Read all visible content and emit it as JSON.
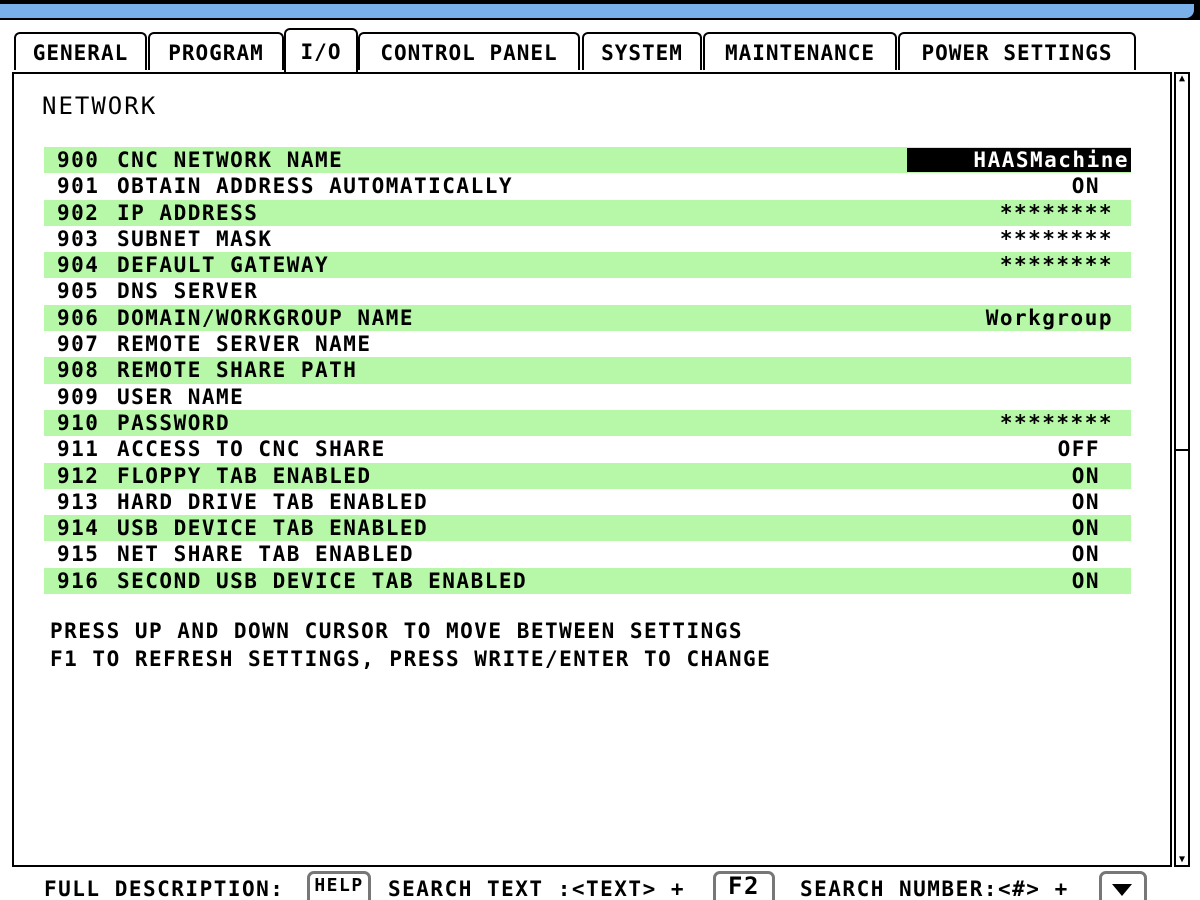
{
  "tabs": [
    {
      "label": "GENERAL"
    },
    {
      "label": "PROGRAM"
    },
    {
      "label": "I/O"
    },
    {
      "label": "CONTROL PANEL"
    },
    {
      "label": "SYSTEM"
    },
    {
      "label": "MAINTENANCE"
    },
    {
      "label": "POWER SETTINGS"
    }
  ],
  "active_tab": "I/O",
  "section": {
    "title": "NETWORK"
  },
  "settings": [
    {
      "num": "900",
      "label": "CNC NETWORK NAME",
      "value": "HAASMachine"
    },
    {
      "num": "901",
      "label": "OBTAIN ADDRESS AUTOMATICALLY",
      "value": "ON"
    },
    {
      "num": "902",
      "label": "IP ADDRESS",
      "value": "********"
    },
    {
      "num": "903",
      "label": "SUBNET MASK",
      "value": "********"
    },
    {
      "num": "904",
      "label": "DEFAULT GATEWAY",
      "value": "********"
    },
    {
      "num": "905",
      "label": "DNS SERVER",
      "value": ""
    },
    {
      "num": "906",
      "label": "DOMAIN/WORKGROUP NAME",
      "value": "Workgroup"
    },
    {
      "num": "907",
      "label": "REMOTE SERVER NAME",
      "value": ""
    },
    {
      "num": "908",
      "label": "REMOTE SHARE PATH",
      "value": ""
    },
    {
      "num": "909",
      "label": "USER NAME",
      "value": ""
    },
    {
      "num": "910",
      "label": "PASSWORD",
      "value": "********"
    },
    {
      "num": "911",
      "label": "ACCESS TO CNC SHARE",
      "value": "OFF"
    },
    {
      "num": "912",
      "label": "FLOPPY TAB ENABLED",
      "value": "ON"
    },
    {
      "num": "913",
      "label": "HARD DRIVE TAB ENABLED",
      "value": "ON"
    },
    {
      "num": "914",
      "label": "USB DEVICE TAB ENABLED",
      "value": "ON"
    },
    {
      "num": "915",
      "label": "NET SHARE TAB ENABLED",
      "value": "ON"
    },
    {
      "num": "916",
      "label": "SECOND USB DEVICE TAB ENABLED",
      "value": "ON"
    }
  ],
  "help": {
    "line1": "PRESS UP AND DOWN CURSOR TO MOVE BETWEEN SETTINGS",
    "line2": "F1 TO REFRESH SETTINGS, PRESS WRITE/ENTER TO CHANGE"
  },
  "footer": {
    "full_description": "FULL DESCRIPTION:",
    "help_key": "HELP",
    "search_text": "SEARCH TEXT :<TEXT> +",
    "f2_key": "F2",
    "search_number": "SEARCH NUMBER:<#> +",
    "down_key_icon": "down-arrow-icon"
  },
  "colors": {
    "row_highlight": "#b7f7a8",
    "title_bar": "#7ab0ea",
    "selected_bg": "#000000",
    "selected_fg": "#ffffff"
  }
}
